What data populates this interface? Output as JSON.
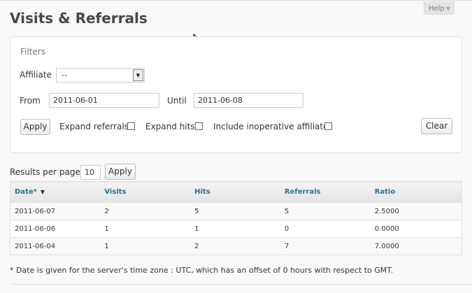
{
  "help": {
    "label": "Help",
    "arrow_icon": "triangle-down-icon"
  },
  "page": {
    "title": "Visits & Referrals"
  },
  "filters": {
    "title": "Filters",
    "affiliate_label": "Affiliate",
    "affiliate_value": "--",
    "from_label": "From",
    "from_value": "2011-06-01",
    "until_label": "Until",
    "until_value": "2011-06-08",
    "apply_label": "Apply",
    "expand_referrals_label": "Expand referrals",
    "expand_hits_label": "Expand hits",
    "include_inoperative_label": "Include inoperative affiliates",
    "clear_label": "Clear"
  },
  "pagination": {
    "results_per_page_label": "Results per page",
    "results_per_page_value": "10",
    "apply_label": "Apply"
  },
  "table": {
    "headers": {
      "date": "Date*",
      "visits": "Visits",
      "hits": "Hits",
      "referrals": "Referrals",
      "ratio": "Ratio"
    },
    "rows": [
      {
        "date": "2011-06-07",
        "visits": "2",
        "hits": "5",
        "referrals": "5",
        "ratio": "2.5000"
      },
      {
        "date": "2011-06-06",
        "visits": "1",
        "hits": "1",
        "referrals": "0",
        "ratio": "0.0000"
      },
      {
        "date": "2011-06-04",
        "visits": "1",
        "hits": "2",
        "referrals": "7",
        "ratio": "7.0000"
      }
    ]
  },
  "footnote": "* Date is given for the server's time zone : UTC, which has an offset of 0 hours with respect to GMT.",
  "colors": {
    "link": "#21759b",
    "border": "#dfdfdf",
    "background": "#f9f9f9"
  }
}
